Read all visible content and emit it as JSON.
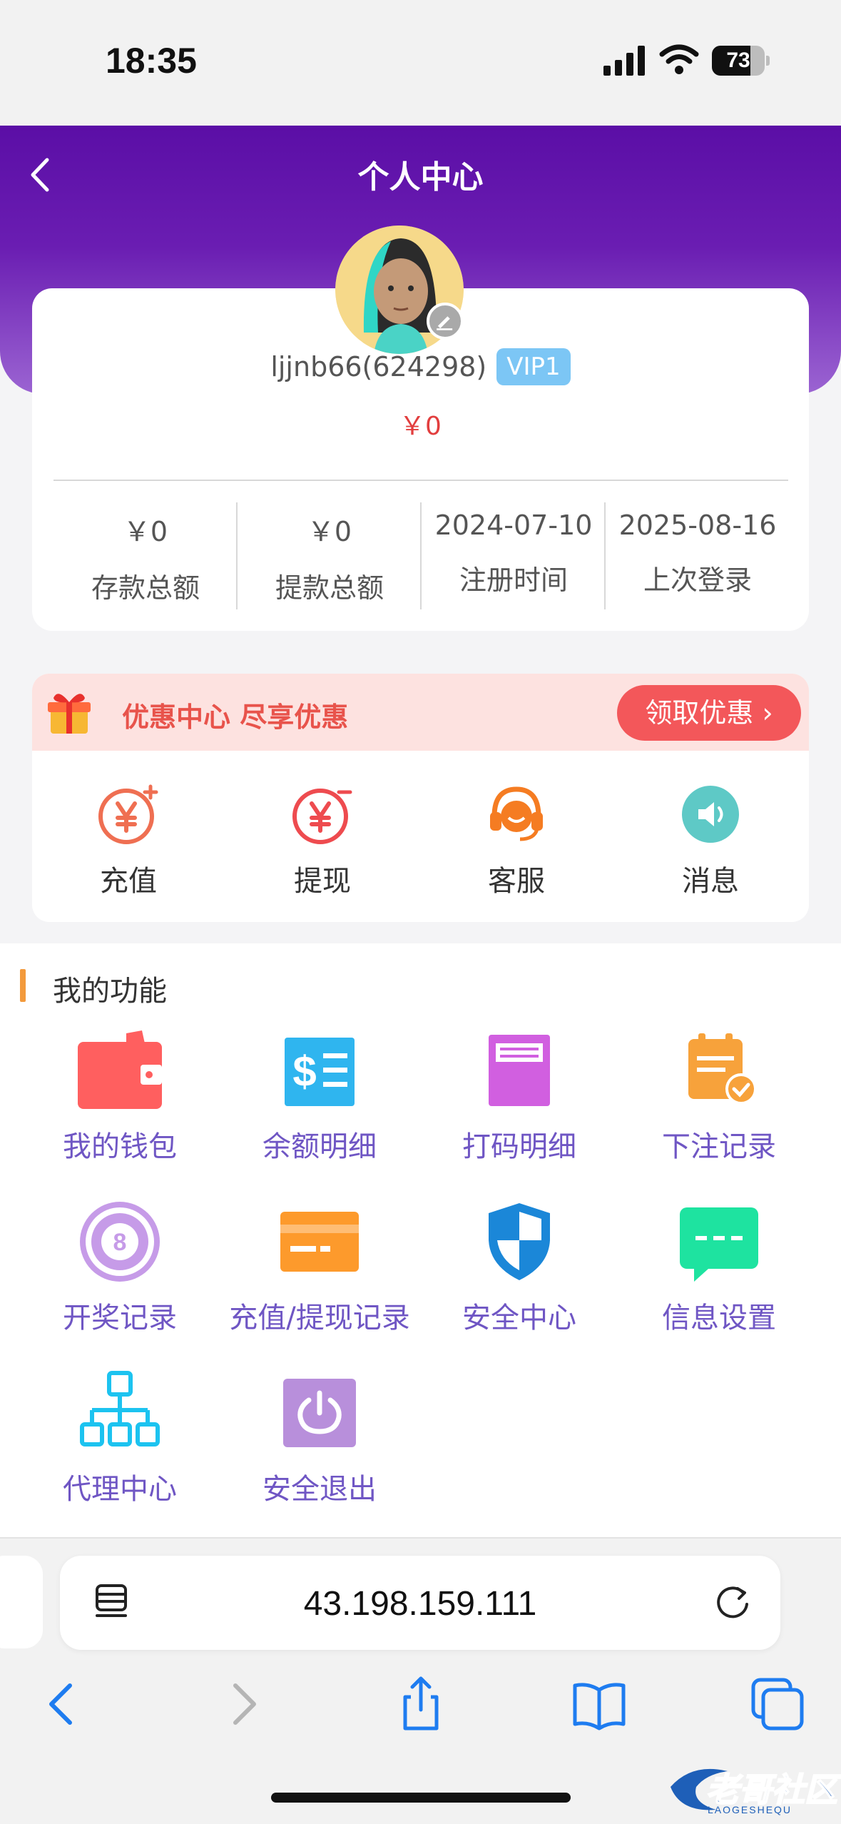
{
  "status_bar": {
    "time": "18:35",
    "battery": "73",
    "battery_level": 0.73
  },
  "header": {
    "title": "个人中心"
  },
  "profile": {
    "username": "ljjnb66(624298)",
    "vip": "VIP1",
    "balance": "￥0",
    "stats": [
      {
        "value": "￥0",
        "label": "存款总额"
      },
      {
        "value": "￥0",
        "label": "提款总额"
      },
      {
        "value": "2024-07-10",
        "label": "注册时间"
      },
      {
        "value": "2025-08-16",
        "label": "上次登录"
      }
    ]
  },
  "promo": {
    "text": "优惠中心 尽享优惠",
    "button": "领取优惠 ›"
  },
  "quick_actions": [
    {
      "label": "充值",
      "icon": "recharge-icon"
    },
    {
      "label": "提现",
      "icon": "withdraw-icon"
    },
    {
      "label": "客服",
      "icon": "customer-service-icon"
    },
    {
      "label": "消息",
      "icon": "message-icon"
    }
  ],
  "functions": {
    "title": "我的功能",
    "items": [
      {
        "label": "我的钱包",
        "icon": "wallet-icon"
      },
      {
        "label": "余额明细",
        "icon": "balance-detail-icon"
      },
      {
        "label": "打码明细",
        "icon": "bet-code-detail-icon"
      },
      {
        "label": "下注记录",
        "icon": "bet-record-icon"
      },
      {
        "label": "开奖记录",
        "icon": "lottery-ball-icon"
      },
      {
        "label": "充值/提现记录",
        "icon": "card-icon"
      },
      {
        "label": "安全中心",
        "icon": "shield-icon"
      },
      {
        "label": "信息设置",
        "icon": "chat-icon"
      },
      {
        "label": "代理中心",
        "icon": "org-chart-icon"
      },
      {
        "label": "安全退出",
        "icon": "power-icon"
      }
    ]
  },
  "browser": {
    "url": "43.198.159.111"
  },
  "watermark": {
    "text": "老哥社区",
    "sub": "LAOGESHEQU"
  },
  "colors": {
    "header": "#5b0ea6",
    "accent_red": "#f3575a",
    "func_label": "#6f56c4",
    "vip": "#7cc6f5"
  }
}
